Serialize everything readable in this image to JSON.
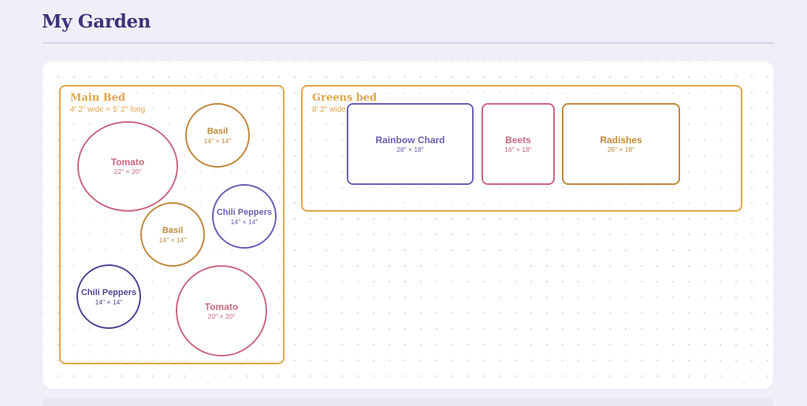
{
  "header": {
    "title": "My Garden"
  },
  "colors": {
    "tomato": "#c9697f",
    "basil": "#c08a3e",
    "chili": "#6b60b5",
    "bed": "#dfa64e",
    "title": "#3b3478"
  },
  "beds": {
    "main": {
      "title": "Main Bed",
      "dims": "4' 2\" wide × 5' 2\" long",
      "plants": {
        "tomato1": {
          "name": "Tomato",
          "size": "22\" × 20\""
        },
        "basil1": {
          "name": "Basil",
          "size": "14\" × 14\""
        },
        "basil2": {
          "name": "Basil",
          "size": "14\" × 14\""
        },
        "chili1": {
          "name": "Chili Peppers",
          "size": "14\" × 14\""
        },
        "chili2": {
          "name": "Chili Peppers",
          "size": "14\" × 14\""
        },
        "tomato2": {
          "name": "Tomato",
          "size": "20\" × 20\""
        }
      }
    },
    "greens": {
      "title": "Greens bed",
      "dims": "8' 2\" wide",
      "plants": {
        "chard": {
          "name": "Rainbow Chard",
          "size": "28\" × 18\""
        },
        "beets": {
          "name": "Beets",
          "size": "16\" × 18\""
        },
        "radishes": {
          "name": "Radishes",
          "size": "26\" × 18\""
        }
      }
    }
  }
}
